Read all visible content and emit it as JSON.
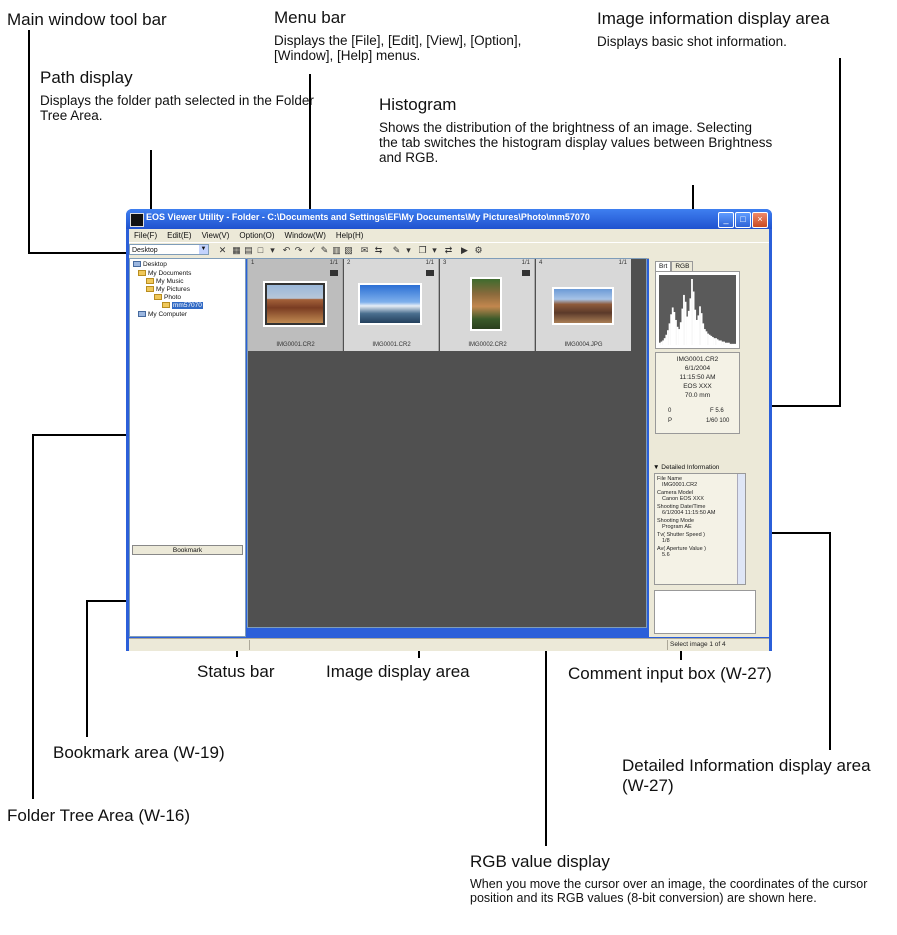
{
  "annotations": {
    "main_window_toolbar": {
      "title": "Main window tool bar"
    },
    "menu_bar": {
      "title": "Menu bar",
      "desc": "Displays the [File], [Edit], [View], [Option], [Window], [Help] menus."
    },
    "image_info": {
      "title": "Image information display area",
      "desc": "Displays basic shot information."
    },
    "path_display": {
      "title": "Path display",
      "desc": "Displays the folder path selected in the Folder Tree Area."
    },
    "histogram": {
      "title": "Histogram",
      "desc": "Shows the distribution of the brightness of an image. Selecting the tab switches the histogram display values between Brightness and RGB."
    },
    "status_bar": {
      "title": "Status bar"
    },
    "image_display": {
      "title": "Image display area"
    },
    "comment_input": {
      "title": "Comment input box (W-27)"
    },
    "bookmark_area": {
      "title": "Bookmark area (W-19)"
    },
    "detailed_info": {
      "title": "Detailed Information display area (W-27)"
    },
    "folder_tree": {
      "title": "Folder Tree Area (W-16)"
    },
    "rgb_value": {
      "title": "RGB value display",
      "desc": "When you move the cursor over an image, the coordinates of the cursor position and its RGB values (8-bit conversion) are shown here."
    }
  },
  "window": {
    "title": "EOS Viewer Utility - Folder - C:\\Documents and Settings\\EF\\My Documents\\My Pictures\\Photo\\mm57070",
    "menu": [
      "File(F)",
      "Edit(E)",
      "View(V)",
      "Option(O)",
      "Window(W)",
      "Help(H)"
    ],
    "drive_select": "Desktop",
    "tree": [
      {
        "label": "Desktop",
        "icon": "pc-icon"
      },
      {
        "label": "My Documents",
        "icon": "folder-icon"
      },
      {
        "label": "My Music",
        "icon": "folder-icon"
      },
      {
        "label": "My Pictures",
        "icon": "folder-icon"
      },
      {
        "label": "Photo",
        "icon": "folder-icon"
      },
      {
        "label": "mm57070",
        "icon": "folder-icon"
      },
      {
        "label": "My Computer",
        "icon": "pc-icon"
      }
    ],
    "bookmark_button": "Bookmark",
    "thumbnails": [
      {
        "index": "1",
        "page": "1/1",
        "name": "IMG0001.CR2"
      },
      {
        "index": "2",
        "page": "1/1",
        "name": "IMG0001.CR2"
      },
      {
        "index": "3",
        "page": "1/1",
        "name": "IMG0002.CR2"
      },
      {
        "index": "4",
        "page": "1/1",
        "name": "IMG0004.JPG"
      }
    ],
    "hist_tabs": [
      "Brt",
      "RGB"
    ],
    "info_lines": [
      "IMG0001.CR2",
      "6/1/2004",
      "11:15:50 AM",
      "EOS XXX",
      "70.0 mm"
    ],
    "info_pairs": [
      [
        "0",
        "F 5.6"
      ],
      [
        "P",
        "1/60 100"
      ]
    ],
    "detail_header": "Detailed Information",
    "detail_rows": [
      {
        "label": "File Name",
        "value": "IMG0001.CR2"
      },
      {
        "label": "Camera Model",
        "value": "Canon EOS XXX"
      },
      {
        "label": "Shooting Date/Time",
        "value": "6/1/2004 11:15:50 AM"
      },
      {
        "label": "Shooting Mode",
        "value": "Program AE"
      },
      {
        "label": "Tv( Shutter Speed )",
        "value": "1/8"
      },
      {
        "label": "Av( Aperture Value )",
        "value": "5.6"
      }
    ],
    "status_text": "Select image 1 of 4",
    "histogram_bins": [
      2,
      3,
      4,
      6,
      9,
      13,
      19,
      27,
      33,
      29,
      22,
      16,
      14,
      20,
      32,
      44,
      38,
      25,
      30,
      41,
      58,
      47,
      31,
      22,
      26,
      34,
      28,
      19,
      14,
      12,
      10,
      9,
      8,
      7,
      6,
      6,
      5,
      4,
      4,
      3,
      3,
      2,
      2,
      2,
      1,
      1,
      1,
      1
    ]
  }
}
